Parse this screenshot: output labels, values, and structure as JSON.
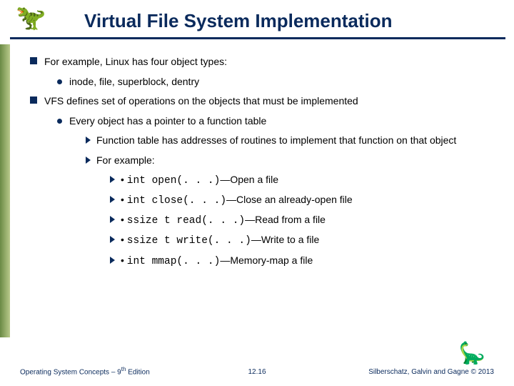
{
  "title": "Virtual File System Implementation",
  "bullets": {
    "b1": "For example, Linux has four object types:",
    "b1a": "inode, file, superblock, dentry",
    "b2": "VFS defines set of operations on the objects that must be implemented",
    "b2a": "Every object has a pointer to a function table",
    "b2a1": "Function table has addresses of routines to implement that function on that object",
    "b2a2": "For example:",
    "fn1_code": "int open(.  .  .)",
    "fn1_desc": "—Open a file",
    "fn2_code": "int close(.  .  .)",
    "fn2_desc": "—Close an already-open file",
    "fn3_code": "ssize t read(.  .  .)",
    "fn3_desc": "—Read from a file",
    "fn4_code": "ssize t write(.  .  .)",
    "fn4_desc": "—Write to a file",
    "fn5_code": "int mmap(.  .  .)",
    "fn5_desc": "—Memory-map a file"
  },
  "footer": {
    "left_a": "Operating System Concepts – 9",
    "left_b": "th",
    "left_c": " Edition",
    "center": "12.16",
    "right": "Silberschatz, Galvin and Gagne © 2013"
  }
}
